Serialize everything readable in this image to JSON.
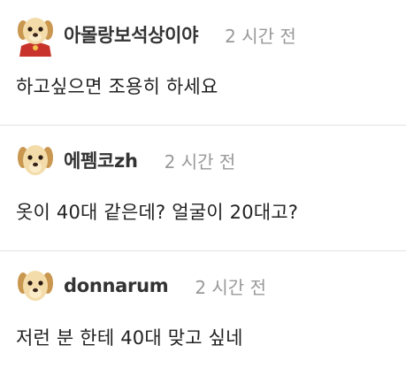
{
  "comments": [
    {
      "username": "아몰랑보석상이야",
      "time": "2 시간 전",
      "text": "하고싶으면 조용히 하세요",
      "avatar_icon": "puppy-with-red-cape-avatar"
    },
    {
      "username": "에펨코zh",
      "time": "2 시간 전",
      "text": "옷이 40대 같은데? 얼굴이 20대고?",
      "avatar_icon": "puppy-avatar"
    },
    {
      "username": "donnarum",
      "time": "2 시간 전",
      "text": "저런 분 한테 40대 맞고 싶네",
      "avatar_icon": "puppy-avatar"
    }
  ],
  "colors": {
    "username": "#333333",
    "time": "#999999",
    "divider": "#e2e2e2",
    "cape": "#c8342b"
  }
}
